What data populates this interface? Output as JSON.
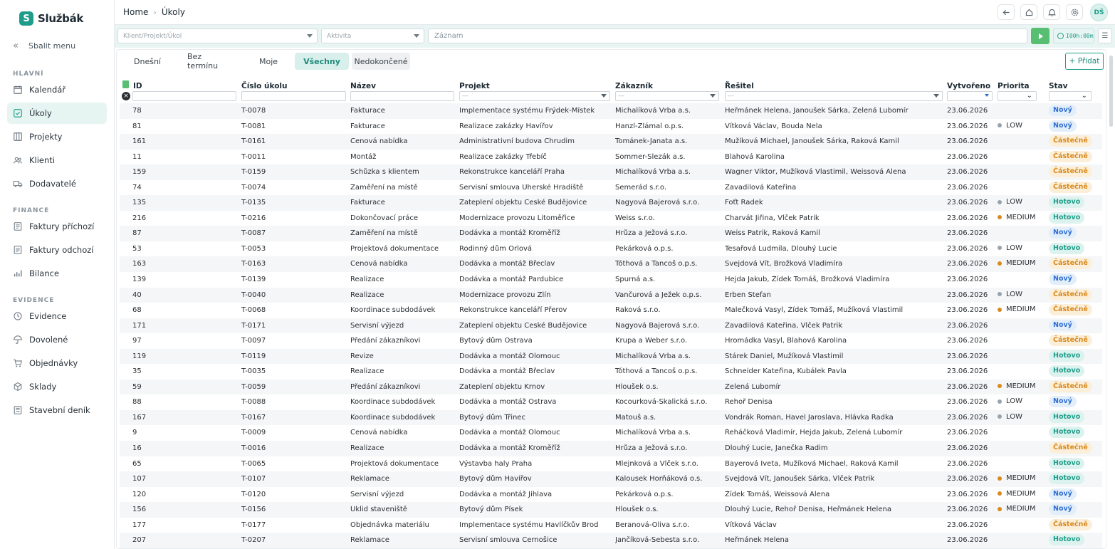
{
  "app": {
    "logo_letter": "S",
    "name": "Službák"
  },
  "sidebar": {
    "collapse_label": "Sbalit menu",
    "sections": [
      {
        "title": "HLAVNÍ",
        "items": [
          {
            "label": "Kalendář",
            "icon": "calendar-icon"
          },
          {
            "label": "Úkoly",
            "icon": "task-check-icon",
            "active": true
          },
          {
            "label": "Projekty",
            "icon": "projects-icon"
          },
          {
            "label": "Klienti",
            "icon": "users-icon"
          },
          {
            "label": "Dodavatelé",
            "icon": "truck-icon"
          }
        ]
      },
      {
        "title": "FINANCE",
        "items": [
          {
            "label": "Faktury příchozí",
            "icon": "invoice-in-icon"
          },
          {
            "label": "Faktury odchozí",
            "icon": "invoice-out-icon"
          },
          {
            "label": "Bilance",
            "icon": "bar-chart-icon"
          }
        ]
      },
      {
        "title": "EVIDENCE",
        "items": [
          {
            "label": "Evidence",
            "icon": "clock-icon"
          },
          {
            "label": "Dovolené",
            "icon": "umbrella-icon"
          },
          {
            "label": "Objednávky",
            "icon": "cart-icon"
          },
          {
            "label": "Sklady",
            "icon": "box-icon"
          },
          {
            "label": "Stavební deník",
            "icon": "journal-icon"
          }
        ]
      }
    ]
  },
  "header": {
    "breadcrumb": [
      "Home",
      "Úkoly"
    ],
    "avatar_initials": "DŠ"
  },
  "timer": {
    "client_placeholder": "Klient/Projekt/Úkol",
    "activity_placeholder": "Aktivita",
    "record_placeholder": "Záznam",
    "time": "I00h:00m"
  },
  "tabs": [
    {
      "label": "Dnešní"
    },
    {
      "label": "Bez termínu"
    },
    {
      "label": "Moje"
    },
    {
      "label": "Všechny",
      "active": true
    },
    {
      "label": "Nedokončené"
    }
  ],
  "add_button": "+ Přidat",
  "table": {
    "columns": [
      "ID",
      "Číslo úkolu",
      "Název",
      "Projekt",
      "Zákazník",
      "Řešitel",
      "Vytvořeno",
      "Priorita",
      "Stav"
    ],
    "filter_placeholder": "---",
    "status_colors": {
      "Nový": "#2f6fd0",
      "Částečně": "#d98a1c",
      "Hotovo": "#1f9d8a"
    },
    "status_bg": {
      "Nový": "#e3eefb",
      "Částečně": "#fcefd9",
      "Hotovo": "#dcf2ee"
    },
    "priority_colors": {
      "LOW": "#98a2ab",
      "MEDIUM": "#d98a1c"
    },
    "rows": [
      [
        "78",
        "T-0078",
        "Fakturace",
        "Implementace systému Frýdek-Místek",
        "Michalíková Vrba a.s.",
        "Heřmánek Helena, Janoušek Šárka, Zelená Lubomír",
        "23.06.2026",
        "",
        "Nový"
      ],
      [
        "81",
        "T-0081",
        "Fakturace",
        "Realizace zakázky Havířov",
        "Hanzl-Zlámal o.p.s.",
        "Vítková Václav, Bouda Nela",
        "23.06.2026",
        "LOW",
        "Nový"
      ],
      [
        "161",
        "T-0161",
        "Cenová nabídka",
        "Administrativní budova Chrudim",
        "Tománek-Janata a.s.",
        "Mužíková Michael, Janoušek Šárka, Raková Kamil",
        "23.06.2026",
        "",
        "Částečně"
      ],
      [
        "11",
        "T-0011",
        "Montáž",
        "Realizace zakázky Třebíč",
        "Sommer-Slezák a.s.",
        "Blahová Karolina",
        "23.06.2026",
        "",
        "Částečně"
      ],
      [
        "159",
        "T-0159",
        "Schůzka s klientem",
        "Rekonstrukce kanceláří Praha",
        "Michalíková Vrba a.s.",
        "Wagner Viktor, Mužíková Vlastimil, Weissová Alena",
        "23.06.2026",
        "",
        "Částečně"
      ],
      [
        "74",
        "T-0074",
        "Zaměření na místě",
        "Servisní smlouva Uherské Hradiště",
        "Semerád s.r.o.",
        "Zavadilová Kateřina",
        "23.06.2026",
        "",
        "Částečně"
      ],
      [
        "135",
        "T-0135",
        "Fakturace",
        "Zateplení objektu České Budějovice",
        "Nagyová Bajerová s.r.o.",
        "Foťt Radek",
        "23.06.2026",
        "LOW",
        "Hotovo"
      ],
      [
        "216",
        "T-0216",
        "Dokončovací práce",
        "Modernizace provozu Litoměřice",
        "Weiss s.r.o.",
        "Charvát Jiřina, Vlček Patrik",
        "23.06.2026",
        "MEDIUM",
        "Hotovo"
      ],
      [
        "87",
        "T-0087",
        "Zaměření na místě",
        "Dodávka a montáž Kroměříž",
        "Hrůza a Ježová s.r.o.",
        "Weiss Patrik, Raková Kamil",
        "23.06.2026",
        "",
        "Nový"
      ],
      [
        "53",
        "T-0053",
        "Projektová dokumentace",
        "Rodinný dům Orlová",
        "Pekárková o.p.s.",
        "Tesařová Ludmila, Dlouhý Lucie",
        "23.06.2026",
        "LOW",
        "Hotovo"
      ],
      [
        "163",
        "T-0163",
        "Cenová nabídka",
        "Dodávka a montáž Břeclav",
        "Tóthová a Tancoš o.p.s.",
        "Švejdová Vít, Brožková Vladimíra",
        "23.06.2026",
        "MEDIUM",
        "Částečně"
      ],
      [
        "139",
        "T-0139",
        "Realizace",
        "Dodávka a montáž Pardubice",
        "Spurná a.s.",
        "Hejda Jakub, Žídek Tomáš, Brožková Vladimíra",
        "23.06.2026",
        "",
        "Nový"
      ],
      [
        "40",
        "T-0040",
        "Realizace",
        "Modernizace provozu Zlín",
        "Vančurová a Ježek o.p.s.",
        "Erben Štefan",
        "23.06.2026",
        "LOW",
        "Částečně"
      ],
      [
        "68",
        "T-0068",
        "Koordinace subdodávek",
        "Rekonstrukce kanceláří Přerov",
        "Raková s.r.o.",
        "Malečková Vasyl, Žídek Tomáš, Mužíková Vlastimil",
        "23.06.2026",
        "MEDIUM",
        "Částečně"
      ],
      [
        "171",
        "T-0171",
        "Servisní výjezd",
        "Zateplení objektu České Budějovice",
        "Nagyová Bajerová s.r.o.",
        "Zavadilová Kateřina, Vlček Patrik",
        "23.06.2026",
        "",
        "Nový"
      ],
      [
        "97",
        "T-0097",
        "Předání zákazníkovi",
        "Bytový dům Ostrava",
        "Krupa a Weber s.r.o.",
        "Hromádka Vasyl, Blahová Karolina",
        "23.06.2026",
        "",
        "Částečně"
      ],
      [
        "119",
        "T-0119",
        "Revize",
        "Dodávka a montáž Olomouc",
        "Michalíková Vrba a.s.",
        "Stárek Daniel, Mužíková Vlastimil",
        "23.06.2026",
        "",
        "Hotovo"
      ],
      [
        "35",
        "T-0035",
        "Realizace",
        "Dodávka a montáž Břeclav",
        "Tóthová a Tancoš o.p.s.",
        "Schneider Kateřina, Kubálek Pavla",
        "23.06.2026",
        "",
        "Hotovo"
      ],
      [
        "59",
        "T-0059",
        "Předání zákazníkovi",
        "Zateplení objektu Krnov",
        "Hloušek o.s.",
        "Zelená Lubomír",
        "23.06.2026",
        "MEDIUM",
        "Částečně"
      ],
      [
        "88",
        "T-0088",
        "Koordinace subdodávek",
        "Dodávka a montáž Ostrava",
        "Kocourková-Skalická s.r.o.",
        "Řehoř Denisa",
        "23.06.2026",
        "LOW",
        "Nový"
      ],
      [
        "167",
        "T-0167",
        "Koordinace subdodávek",
        "Bytový dům Třinec",
        "Matouš a.s.",
        "Vondrák Roman, Havel Jaroslava, Hlávka Radka",
        "23.06.2026",
        "LOW",
        "Hotovo"
      ],
      [
        "9",
        "T-0009",
        "Cenová nabídka",
        "Dodávka a montáž Olomouc",
        "Michalíková Vrba a.s.",
        "Řeháčková Vladimír, Hejda Jakub, Zelená Lubomír",
        "23.06.2026",
        "",
        "Hotovo"
      ],
      [
        "16",
        "T-0016",
        "Realizace",
        "Dodávka a montáž Kroměříž",
        "Hrůza a Ježová s.r.o.",
        "Dlouhý Lucie, Janečka Radim",
        "23.06.2026",
        "",
        "Částečně"
      ],
      [
        "65",
        "T-0065",
        "Projektová dokumentace",
        "Výstavba haly Praha",
        "Mlejnková a Vlček s.r.o.",
        "Bayerová Iveta, Mužíková Michael, Raková Kamil",
        "23.06.2026",
        "",
        "Hotovo"
      ],
      [
        "107",
        "T-0107",
        "Reklamace",
        "Bytový dům Havířov",
        "Kalousek Horňáková o.s.",
        "Švejdová Vít, Janoušek Šárka, Vlček Patrik",
        "23.06.2026",
        "MEDIUM",
        "Hotovo"
      ],
      [
        "120",
        "T-0120",
        "Servisní výjezd",
        "Dodávka a montáž Jihlava",
        "Pekárková o.p.s.",
        "Žídek Tomáš, Weissová Alena",
        "23.06.2026",
        "MEDIUM",
        "Nový"
      ],
      [
        "156",
        "T-0156",
        "Úklid staveniště",
        "Bytový dům Písek",
        "Hloušek o.s.",
        "Dlouhý Lucie, Řehoř Denisa, Heřmánek Helena",
        "23.06.2026",
        "MEDIUM",
        "Nový"
      ],
      [
        "177",
        "T-0177",
        "Objednávka materiálu",
        "Implementace systému Havlíčkův Brod",
        "Beranová-Oliva s.r.o.",
        "Vítková Václav",
        "23.06.2026",
        "",
        "Částečně"
      ],
      [
        "207",
        "T-0207",
        "Reklamace",
        "Servisní smlouva Černošice",
        "Jančíková-Šebesta s.r.o.",
        "Heřmánek Helena",
        "23.06.2026",
        "",
        "Hotovo"
      ]
    ]
  }
}
